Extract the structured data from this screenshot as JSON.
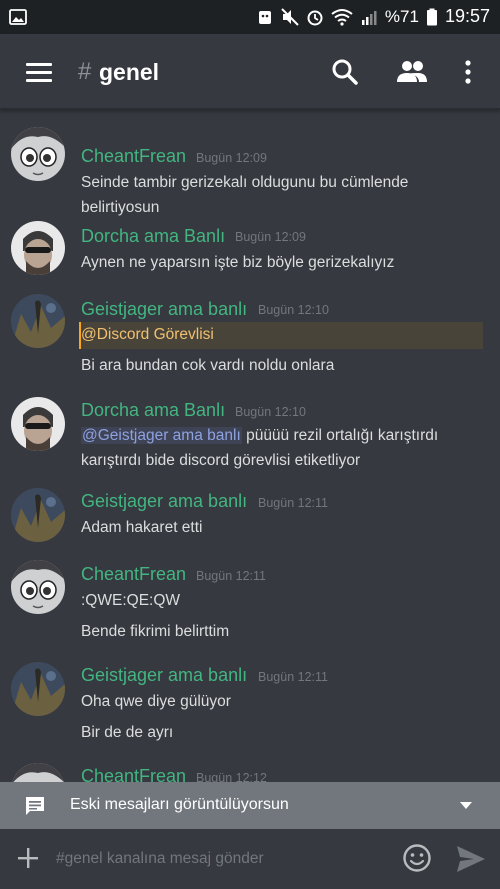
{
  "status_bar": {
    "battery": "%71",
    "time": "19:57"
  },
  "channel": {
    "hash": "#",
    "name": "genel"
  },
  "messages": [
    {
      "author": "CheantFrean",
      "time": "Bugün 12:09",
      "lines": [
        "Seinde tambir gerizekalı oldugunu bu cümlende",
        "belirtiyosun"
      ]
    },
    {
      "author": "Dorcha ama Banlı",
      "time": "Bugün 12:09",
      "lines": [
        "Aynen ne yaparsın işte biz böyle gerizekalıyız"
      ]
    },
    {
      "author": "Geistjager ama banlı",
      "time": "Bugün 12:10",
      "mention": "@Discord Görevlisi",
      "lines": [
        "Bi ara bundan cok vardı noldu onlara"
      ]
    },
    {
      "author": "Dorcha ama Banlı",
      "time": "Bugün 12:10",
      "mention": "@Geistjager ama banlı",
      "line1_rest": " püüüü rezil ortalığı karıştırdı",
      "lines": [
        "karıştırdı bide discord görevlisi etiketliyor"
      ]
    },
    {
      "author": "Geistjager ama banlı",
      "time": "Bugün 12:11",
      "lines": [
        "Adam hakaret etti"
      ]
    },
    {
      "author": "CheantFrean",
      "time": "Bugün 12:11",
      "lines": [
        ":QWE:QE:QW",
        "Bende fikrimi belirttim"
      ]
    },
    {
      "author": "Geistjager ama banlı",
      "time": "Bugün 12:11",
      "lines": [
        "Oha qwe diye gülüyor",
        "Bir de de ayrı"
      ]
    },
    {
      "author": "CheantFrean",
      "time": "Bugün 12:12",
      "lines": []
    }
  ],
  "banner": {
    "text": "Eski mesajları görüntülüyorsun"
  },
  "composer": {
    "placeholder": "#genel kanalına mesaj gönder"
  },
  "colors": {
    "background": "#36393f",
    "username_green": "#43b581",
    "mention_gold": "#faa61a",
    "banner": "#72767d"
  }
}
